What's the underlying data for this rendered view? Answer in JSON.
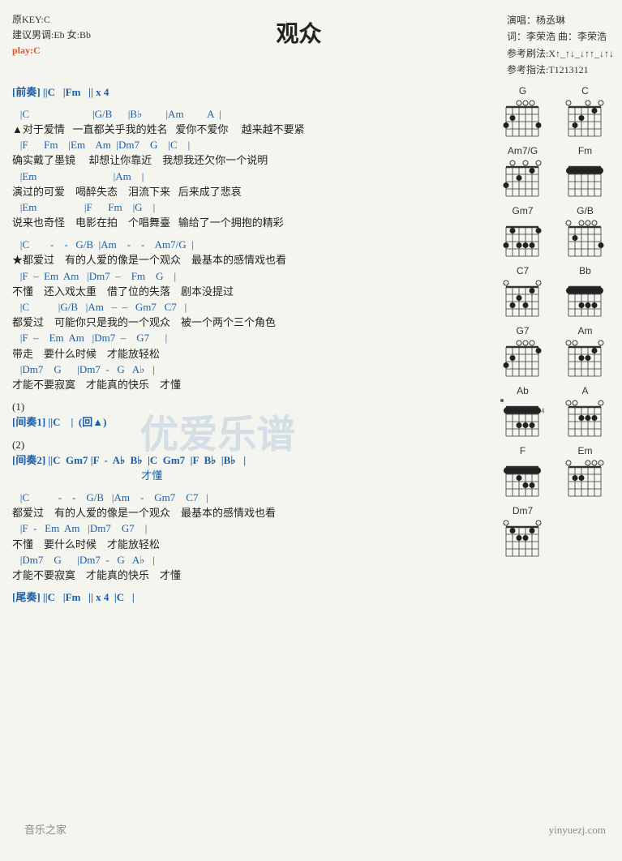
{
  "header": {
    "original_key": "原KEY:C",
    "suggested_key": "建议男调:Eb 女:Bb",
    "play": "play:C",
    "title": "观众",
    "singer": "演唱：杨丞琳",
    "lyricist": "词：李荣浩  曲：李荣浩",
    "strum": "参考刷法:X↑_↑↓_↓↑↑_↓↑↓",
    "fingerpick": "参考指法:T1213121"
  },
  "watermark": "优爱乐谱",
  "watermark_url": "yinyuezj.com",
  "watermark_bottom": "音乐之家",
  "watermark_bottom_url": "yinyuezj.com",
  "lines": [
    {
      "type": "section",
      "text": "[前奏] ||C   |Fm   || x 4"
    },
    {
      "type": "spacer"
    },
    {
      "type": "chord",
      "text": "   |C                        |G/B      |B♭         |Am         A  |"
    },
    {
      "type": "lyric",
      "text": "▲对于爱情   一直都关乎我的姓名   爱你不爱你     越来越不要紧"
    },
    {
      "type": "chord",
      "text": "   |F      Fm    |Em    Am  |Dm7    G    |C    |"
    },
    {
      "type": "lyric",
      "text": "确实戴了墨镜     却想让你靠近    我想我还欠你一个说明"
    },
    {
      "type": "chord",
      "text": "   |Em                             |Am    |"
    },
    {
      "type": "lyric",
      "text": "演过的可爱    喝醉失态    泪流下来   后来成了悲哀"
    },
    {
      "type": "chord",
      "text": "   |Em                  |F      Fm    |G    |"
    },
    {
      "type": "lyric",
      "text": "说来也奇怪    电影在拍    个唱舞臺   输给了一个拥抱的精彩"
    },
    {
      "type": "spacer"
    },
    {
      "type": "chord",
      "text": "   |C        -    -   G/B  |Am    -    -    Am7/G  |"
    },
    {
      "type": "lyric",
      "text": "★都爱过    有的人爱的像是一个观众    最基本的感情戏也看"
    },
    {
      "type": "chord",
      "text": "   |F  –  Em  Am   |Dm7  –    Fm    G    |"
    },
    {
      "type": "lyric",
      "text": "不懂    还入戏太重    借了位的失落    剧本没提过"
    },
    {
      "type": "chord",
      "text": "   |C           |G/B   |Am   –  –   Gm7   C7   |"
    },
    {
      "type": "lyric",
      "text": "都爱过    可能你只是我的一个观众    被一个两个三个角色"
    },
    {
      "type": "chord",
      "text": "   |F  –    Em  Am   |Dm7  –    G7      |"
    },
    {
      "type": "lyric",
      "text": "带走    要什么时候    才能放轻松"
    },
    {
      "type": "chord",
      "text": "   |Dm7    G      |Dm7  -   G   A♭   |"
    },
    {
      "type": "lyric",
      "text": "才能不要寂寞    才能真的快乐    才懂"
    },
    {
      "type": "spacer"
    },
    {
      "type": "lyric",
      "text": "(1)"
    },
    {
      "type": "section",
      "text": "[间奏1] ||C    |  (回▲)"
    },
    {
      "type": "spacer"
    },
    {
      "type": "lyric",
      "text": "(2)"
    },
    {
      "type": "section",
      "text": "[间奏2] ||C  Gm7 |F  -  A♭  B♭  |C  Gm7  |F  B♭  |B♭   |"
    },
    {
      "type": "chord",
      "text": "                                                 才懂"
    },
    {
      "type": "spacer"
    },
    {
      "type": "chord",
      "text": "   |C           -    -    G/B   |Am    -    Gm7    C7   |"
    },
    {
      "type": "lyric",
      "text": "都爱过    有的人爱的像是一个观众    最基本的感情戏也看"
    },
    {
      "type": "chord",
      "text": "   |F  -   Em  Am   |Dm7    G7    |"
    },
    {
      "type": "lyric",
      "text": "不懂    要什么时候    才能放轻松"
    },
    {
      "type": "chord",
      "text": "   |Dm7    G      |Dm7  -   G   A♭   |"
    },
    {
      "type": "lyric",
      "text": "才能不要寂寞    才能真的快乐    才懂"
    },
    {
      "type": "spacer"
    },
    {
      "type": "section",
      "text": "[尾奏] ||C   |Fm   || x 4  |C   |"
    }
  ],
  "chords": [
    {
      "name": "G",
      "frets": [
        3,
        2,
        0,
        0,
        0,
        3
      ],
      "open": [
        false,
        false,
        true,
        true,
        true,
        false
      ],
      "barre": null,
      "startFret": 1
    },
    {
      "name": "C",
      "frets": [
        0,
        3,
        2,
        0,
        1,
        0
      ],
      "open": [
        true,
        false,
        false,
        true,
        false,
        true
      ],
      "barre": null,
      "startFret": 1
    },
    {
      "name": "Am7/G",
      "frets": [
        3,
        0,
        2,
        0,
        1,
        0
      ],
      "open": [
        false,
        true,
        false,
        true,
        false,
        true
      ],
      "barre": null,
      "startFret": 1
    },
    {
      "name": "Fm",
      "frets": [
        1,
        1,
        1,
        1,
        1,
        1
      ],
      "open": [
        false,
        false,
        false,
        false,
        false,
        false
      ],
      "barre": 1,
      "startFret": 1
    },
    {
      "name": "Gm7",
      "frets": [
        3,
        1,
        3,
        3,
        3,
        1
      ],
      "open": [
        false,
        false,
        false,
        false,
        false,
        false
      ],
      "barre": null,
      "startFret": 1
    },
    {
      "name": "G/B",
      "frets": [
        0,
        2,
        0,
        0,
        0,
        3
      ],
      "open": [
        true,
        false,
        true,
        true,
        true,
        false
      ],
      "barre": null,
      "startFret": 1
    },
    {
      "name": "C7",
      "frets": [
        0,
        3,
        2,
        3,
        1,
        0
      ],
      "open": [
        true,
        false,
        false,
        false,
        false,
        true
      ],
      "barre": null,
      "startFret": 1
    },
    {
      "name": "Bb",
      "frets": [
        1,
        1,
        3,
        3,
        3,
        1
      ],
      "open": [
        false,
        false,
        false,
        false,
        false,
        false
      ],
      "barre": 1,
      "startFret": 1
    },
    {
      "name": "G7",
      "frets": [
        3,
        2,
        0,
        0,
        0,
        1
      ],
      "open": [
        false,
        false,
        true,
        true,
        true,
        false
      ],
      "barre": null,
      "startFret": 1
    },
    {
      "name": "Am",
      "frets": [
        0,
        0,
        2,
        2,
        1,
        0
      ],
      "open": [
        true,
        true,
        false,
        false,
        false,
        true
      ],
      "barre": null,
      "startFret": 1
    },
    {
      "name": "Ab",
      "frets": [
        4,
        4,
        6,
        6,
        6,
        4
      ],
      "open": [
        false,
        false,
        false,
        false,
        false,
        false
      ],
      "barre": 4,
      "startFret": 4
    },
    {
      "name": "A",
      "frets": [
        0,
        0,
        2,
        2,
        2,
        0
      ],
      "open": [
        true,
        true,
        false,
        false,
        false,
        true
      ],
      "barre": null,
      "startFret": 1
    },
    {
      "name": "F",
      "frets": [
        1,
        1,
        2,
        3,
        3,
        1
      ],
      "open": [
        false,
        false,
        false,
        false,
        false,
        false
      ],
      "barre": 1,
      "startFret": 1
    },
    {
      "name": "Em",
      "frets": [
        0,
        2,
        2,
        0,
        0,
        0
      ],
      "open": [
        true,
        false,
        false,
        true,
        true,
        true
      ],
      "barre": null,
      "startFret": 1
    },
    {
      "name": "Dm7",
      "frets": [
        0,
        1,
        2,
        2,
        1,
        0
      ],
      "open": [
        true,
        false,
        false,
        false,
        false,
        true
      ],
      "barre": null,
      "startFret": 1
    }
  ]
}
